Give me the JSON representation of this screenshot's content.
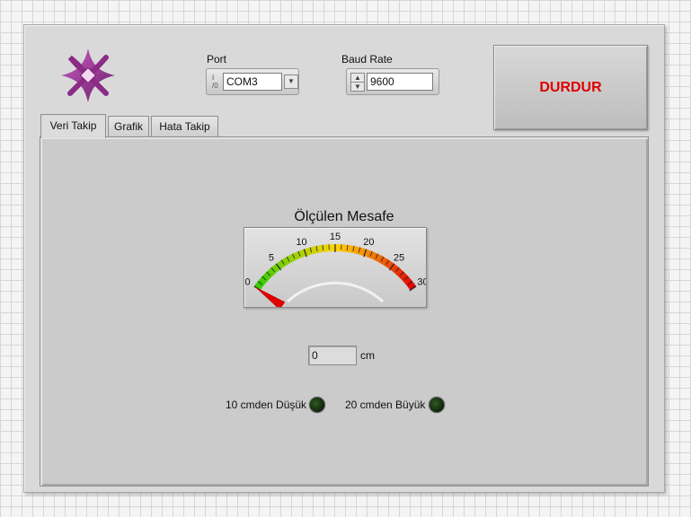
{
  "header": {
    "port": {
      "label": "Port",
      "value": "COM3",
      "io_glyph": "I/O"
    },
    "baud": {
      "label": "Baud Rate",
      "value": "9600"
    },
    "stop_label": "DURDUR"
  },
  "tabs": [
    {
      "label": "Veri Takip",
      "active": true
    },
    {
      "label": "Grafik",
      "active": false
    },
    {
      "label": "Hata Takip",
      "active": false
    }
  ],
  "gauge": {
    "title": "Ölçülen Mesafe",
    "min": 0,
    "max": 30,
    "value": 0,
    "tick_labels": [
      "0",
      "5",
      "10",
      "15",
      "20",
      "25",
      "30"
    ],
    "colors": {
      "low": "#2ecc00",
      "mid": "#ffd400",
      "high": "#e00000"
    }
  },
  "readout": {
    "value": "0",
    "unit": "cm"
  },
  "indicators": [
    {
      "label": "10 cmden Düşük",
      "on": false
    },
    {
      "label": "20 cmden Büyük",
      "on": false
    }
  ],
  "colors": {
    "stop_text": "#e00000",
    "logo": "#a0369a"
  }
}
